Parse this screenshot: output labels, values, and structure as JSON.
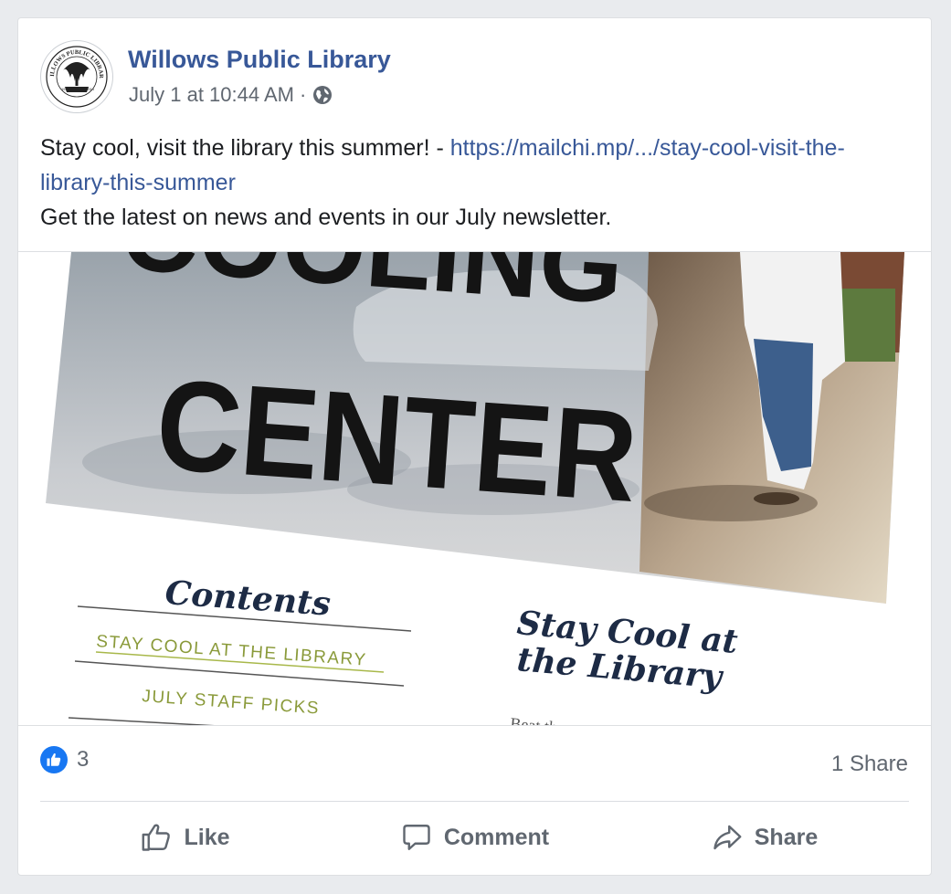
{
  "post": {
    "page_name": "Willows Public Library",
    "timestamp": "July 1 at 10:44 AM",
    "separator": "·",
    "privacy_icon": "globe-icon",
    "text_line1": "Stay cool, visit the library this summer! - ",
    "link": "https://mailchi.mp/.../stay-cool-visit-the-library-this-summer",
    "text_line2": "Get the latest on news and events in our July newsletter."
  },
  "avatar": {
    "text_top": "WILLOWS PUBLIC LIBRARY",
    "year_left": "1914",
    "year_right": "2014"
  },
  "image": {
    "sign_line1": "COOLING",
    "sign_line2": "CENTER",
    "contents_heading": "Contents",
    "contents_items": [
      "STAY COOL AT THE LIBRARY",
      "JULY STAFF PICKS"
    ],
    "article_title_line1": "Stay Cool at",
    "article_title_line2": "the Library",
    "article_snippet": "Beat th..."
  },
  "stats": {
    "like_count": "3",
    "share_count": "1 Share"
  },
  "actions": {
    "like": "Like",
    "comment": "Comment",
    "share": "Share"
  },
  "colors": {
    "link": "#385898",
    "like_blue": "#1877f2",
    "secondary_text": "#606770"
  }
}
